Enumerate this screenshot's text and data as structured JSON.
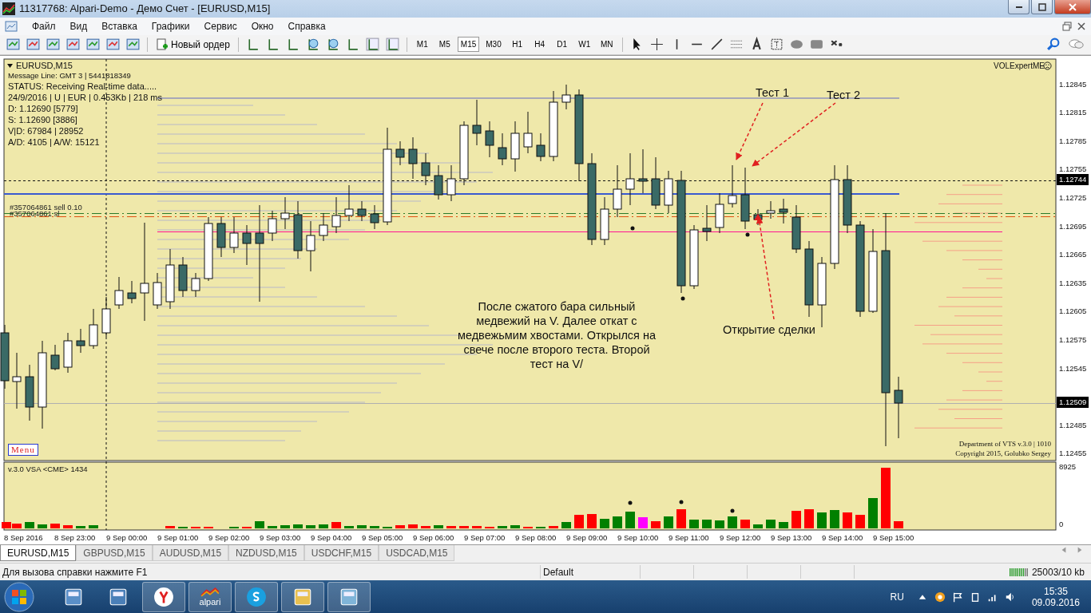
{
  "window": {
    "title": "11317768: Alpari-Demo - Демо Счет - [EURUSD,M15]"
  },
  "menu": [
    "Файл",
    "Вид",
    "Вставка",
    "Графики",
    "Сервис",
    "Окно",
    "Справка"
  ],
  "toolbar": {
    "new_order": "Новый ордер",
    "timeframes": [
      {
        "label": "M1",
        "selected": false
      },
      {
        "label": "M5",
        "selected": false
      },
      {
        "label": "M15",
        "selected": true
      },
      {
        "label": "M30",
        "selected": false
      },
      {
        "label": "H1",
        "selected": false
      },
      {
        "label": "H4",
        "selected": false
      },
      {
        "label": "D1",
        "selected": false
      },
      {
        "label": "W1",
        "selected": false
      },
      {
        "label": "MN",
        "selected": false
      }
    ]
  },
  "chart": {
    "symbol": "EURUSD,M15",
    "info_lines": [
      "Message Line: GMT 3 | 5441818349",
      "STATUS:  Receiving Real-time data.....",
      "24/9/2016 | U | EUR | 0.453Kb | 218 ms",
      "D: 1.12690  [5779]",
      "S: 1.12690  [3886]",
      "V|D: 67984 | 28952",
      "A/D: 4105 | A/W: 15121"
    ],
    "expert": "VOLExpertME",
    "order_labels": [
      "#357064861 sell 0.10",
      "#357064861 sl"
    ],
    "price_ticks": [
      "1.12845",
      "1.12815",
      "1.12785",
      "1.12755",
      "1.12725",
      "1.12695",
      "1.12665",
      "1.12635",
      "1.12605",
      "1.12575",
      "1.12545",
      "1.12485",
      "1.12455"
    ],
    "price_markers": [
      "1.12744",
      "1.12509"
    ],
    "annotations": [
      "Тест 1",
      "Тест 2",
      "После сжатого бара сильный медвежий на V. Далее откат с медвежьмим хвостами. Открылся на свече после второго теста. Второй тест на V/",
      "Открытие сделки"
    ],
    "menu_button": "Menu",
    "credits": [
      "Department of VTS  v.3.0 | 1010",
      "Copyright 2015, Golubko Sergey"
    ]
  },
  "volume": {
    "label": "v.3.0 VSA <CME> 1434",
    "ticks": [
      "8925",
      "0"
    ]
  },
  "time_axis": [
    "8 Sep 2016",
    "8 Sep 23:00",
    "9 Sep 00:00",
    "9 Sep 01:00",
    "9 Sep 02:00",
    "9 Sep 03:00",
    "9 Sep 04:00",
    "9 Sep 05:00",
    "9 Sep 06:00",
    "9 Sep 07:00",
    "9 Sep 08:00",
    "9 Sep 09:00",
    "9 Sep 10:00",
    "9 Sep 11:00",
    "9 Sep 12:00",
    "9 Sep 13:00",
    "9 Sep 14:00",
    "9 Sep 15:00"
  ],
  "tabs": [
    {
      "label": "EURUSD,M15",
      "selected": true
    },
    {
      "label": "GBPUSD,M15",
      "selected": false
    },
    {
      "label": "AUDUSD,M15",
      "selected": false
    },
    {
      "label": "NZDUSD,M15",
      "selected": false
    },
    {
      "label": "USDCHF,M15",
      "selected": false
    },
    {
      "label": "USDCAD,M15",
      "selected": false
    }
  ],
  "status_bar": {
    "help": "Для вызова справки нажмите F1",
    "profile": "Default",
    "traffic": "25003/10 kb"
  },
  "taskbar": {
    "apps": [
      {
        "kind": "calculator"
      },
      {
        "kind": "computer"
      },
      {
        "kind": "yandex"
      },
      {
        "kind": "alpari",
        "label": "alpari"
      },
      {
        "kind": "skype"
      },
      {
        "kind": "folder"
      },
      {
        "kind": "notepad"
      }
    ],
    "language": "RU",
    "time": "15:35",
    "date": "09.09.2016"
  }
}
